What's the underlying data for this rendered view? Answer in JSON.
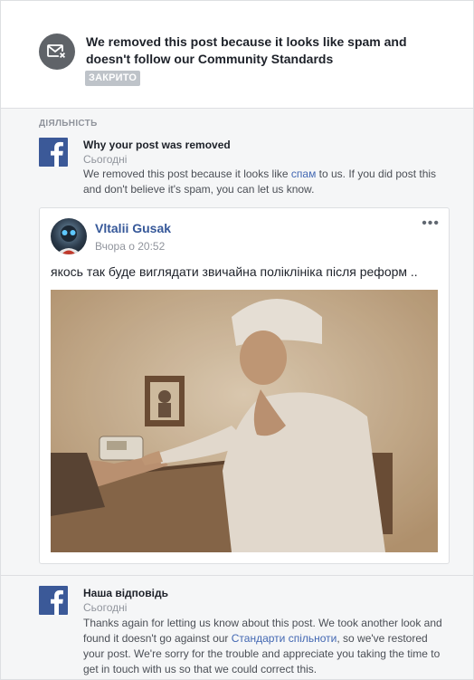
{
  "header": {
    "title": "We removed this post because it looks like spam and doesn't follow our Community Standards",
    "status_badge": "ЗАКРИТО",
    "icon": "message-removed-icon"
  },
  "activity": {
    "section_label": "ДІЯЛЬНІСТЬ",
    "items": [
      {
        "title": "Why your post was removed",
        "date": "Сьогодні",
        "text_before": "We removed this post because it looks like ",
        "link": "спам",
        "text_after": " to us. If you did post this and don't believe it's spam, you can let us know."
      },
      {
        "title": "Наша відповідь",
        "date": "Сьогодні",
        "text_before": "Thanks again for letting us know about this post. We took another look and found it doesn't go against our ",
        "link": "Стандарти спільноти",
        "text_after": ", so we've restored your post. We're sorry for the trouble and appreciate you taking the time to get in touch with us so that we could correct this."
      }
    ]
  },
  "post": {
    "author": "Vltalii Gusak",
    "time": "Вчора о 20:52",
    "more": "•••",
    "text": "якось так буде виглядати звичайна поліклініка після реформ ..",
    "photo_icon": "nurse-photo"
  },
  "colors": {
    "facebook_blue": "#3b5998",
    "link": "#4267b2",
    "badge": "#bec3c9",
    "background": "#f5f6f7"
  }
}
